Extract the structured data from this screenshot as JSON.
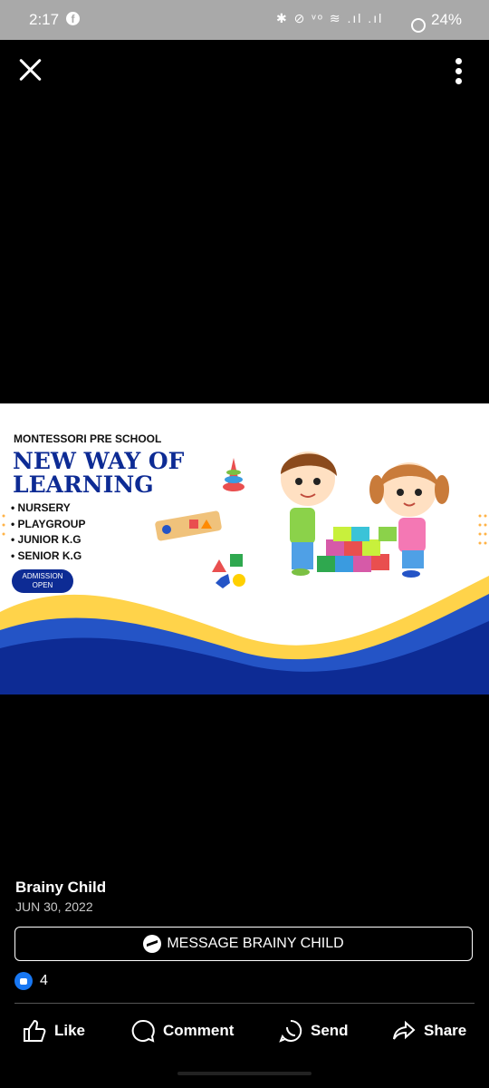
{
  "status_bar": {
    "time": "2:17",
    "app_icon": "facebook-icon",
    "system_icons": "✱ ⊘ ᵛᵒ ≋ .ıl .ıl",
    "battery": "24%"
  },
  "top_bar": {
    "close_icon": "close-icon",
    "more_icon": "more-vertical-icon"
  },
  "photo": {
    "pre_title": "MONTESSORI PRE SCHOOL",
    "headline": "NEW WAY OF LEARNING",
    "programs": [
      "NURSERY",
      "PLAYGROUP",
      "JUNIOR K.G",
      "SENIOR K.G"
    ],
    "badge": "ADMISSION OPEN",
    "colors": {
      "navy": "#0d2b94",
      "yellow": "#ffd34a",
      "blue": "#2454c6"
    }
  },
  "post": {
    "author": "Brainy Child",
    "date": "JUN 30, 2022",
    "message_button": "MESSAGE BRAINY CHILD",
    "like_count": "4"
  },
  "actions": [
    {
      "label": "Like",
      "icon": "thumbs-up-icon"
    },
    {
      "label": "Comment",
      "icon": "comment-icon"
    },
    {
      "label": "Send",
      "icon": "whatsapp-icon"
    },
    {
      "label": "Share",
      "icon": "share-icon"
    }
  ]
}
